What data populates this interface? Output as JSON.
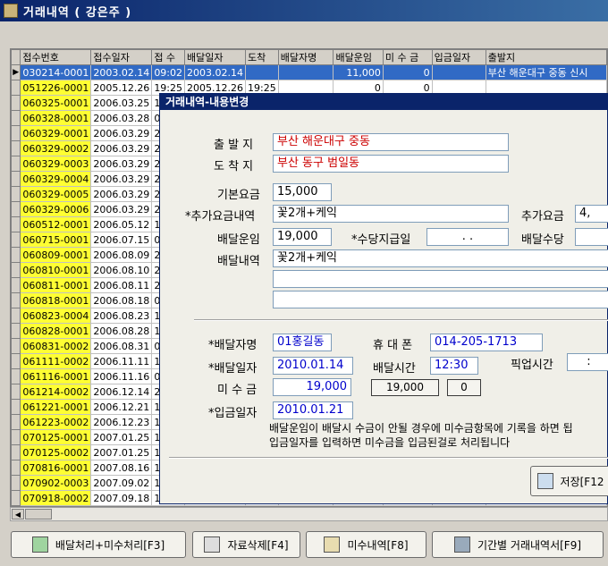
{
  "window": {
    "title": "거래내역 ( 강은주 )"
  },
  "grid": {
    "columns": [
      "접수번호",
      "접수일자",
      "접 수",
      "배달일자",
      "도착",
      "배달자명",
      "배달운임",
      "미 수 금",
      "입금일자",
      "출발지"
    ],
    "rows": [
      [
        "030214-0001",
        "2003.02.14",
        "09:02",
        "2003.02.14",
        "",
        "",
        "11,000",
        "0",
        "",
        "부산 해운대구 중동 신시"
      ],
      [
        "051226-0001",
        "2005.12.26",
        "19:25",
        "2005.12.26",
        "19:25",
        "",
        "0",
        "0",
        "",
        ""
      ],
      [
        "060325-0001",
        "2006.03.25",
        "15"
      ],
      [
        "060328-0001",
        "2006.03.28",
        "08"
      ],
      [
        "060329-0001",
        "2006.03.29",
        "20"
      ],
      [
        "060329-0002",
        "2006.03.29",
        "21"
      ],
      [
        "060329-0003",
        "2006.03.29",
        "21"
      ],
      [
        "060329-0004",
        "2006.03.29",
        "21"
      ],
      [
        "060329-0005",
        "2006.03.29",
        "21"
      ],
      [
        "060329-0006",
        "2006.03.29",
        "21"
      ],
      [
        "060512-0001",
        "2006.05.12",
        "10"
      ],
      [
        "060715-0001",
        "2006.07.15",
        "09"
      ],
      [
        "060809-0001",
        "2006.08.09",
        "23"
      ],
      [
        "060810-0001",
        "2006.08.10",
        "20"
      ],
      [
        "060811-0001",
        "2006.08.11",
        "22"
      ],
      [
        "060818-0001",
        "2006.08.18",
        "01"
      ],
      [
        "060823-0004",
        "2006.08.23",
        "18"
      ],
      [
        "060828-0001",
        "2006.08.28",
        "13"
      ],
      [
        "060831-0002",
        "2006.08.31",
        "00"
      ],
      [
        "061111-0002",
        "2006.11.11",
        "13"
      ],
      [
        "061116-0001",
        "2006.11.16",
        "00"
      ],
      [
        "061214-0002",
        "2006.12.14",
        "20"
      ],
      [
        "061221-0001",
        "2006.12.21",
        "10"
      ],
      [
        "061223-0002",
        "2006.12.23",
        "10"
      ],
      [
        "070125-0001",
        "2007.01.25",
        "10"
      ],
      [
        "070125-0002",
        "2007.01.25",
        "10"
      ],
      [
        "070816-0001",
        "2007.08.16",
        "15"
      ],
      [
        "070902-0003",
        "2007.09.02",
        "18"
      ],
      [
        "070918-0002",
        "2007.09.18",
        "17"
      ]
    ]
  },
  "dialog": {
    "title": "거래내역-내용변경",
    "labels": {
      "departure": "출 발 지",
      "arrival": "도 착 지",
      "base_fee": "기본요금",
      "extra_fee_detail": "*추가요금내역",
      "extra_fee": "추가요금",
      "delivery_fare": "배달운임",
      "allowance_date": "*수당지급일",
      "delivery_allowance": "배달수당",
      "delivery_detail": "배달내역",
      "courier_name": "*배달자명",
      "mobile": "휴 대 폰",
      "delivery_date": "*배달일자",
      "delivery_time": "배달시간",
      "pickup_time": "픽업시간",
      "unpaid": "미 수 금",
      "deposit_date": "*입금일자"
    },
    "values": {
      "departure": "부산 해운대구 중동",
      "arrival": "부산 동구 범일동",
      "base_fee": "15,000",
      "extra_fee_detail": "꽃2개+케익",
      "extra_fee": "4,",
      "delivery_fare": "19,000",
      "allowance_date": ".   .",
      "delivery_allowance": "",
      "delivery_detail_1": "꽃2개+케익",
      "delivery_detail_2": "",
      "delivery_detail_3": "",
      "courier_name": "01홍길동",
      "mobile": "014-205-1713",
      "delivery_date": "2010.01.14",
      "delivery_time": "12:30",
      "pickup_time": ":",
      "unpaid": "19,000",
      "deposit_date": "2010.01.21"
    },
    "buttons": {
      "amount": "19,000",
      "zero": "0",
      "save": "저장[F12"
    },
    "note_1": "배달운임이 배달시 수금이 안될 경우에 미수금항목에 기록을 하면 됩",
    "note_2": "입금일자를 입력하면 미수금을 입금된걸로 처리됩니다"
  },
  "bottom_buttons": [
    {
      "label": "배달처리+미수처리[F3]"
    },
    {
      "label": "자료삭제[F4]"
    },
    {
      "label": "미수내역[F8]"
    },
    {
      "label": "기간별 거래내역서[F9]"
    }
  ],
  "colors": {
    "title_bar": "#0a246a",
    "highlight": "#ffff33",
    "selection": "#316ac5"
  }
}
